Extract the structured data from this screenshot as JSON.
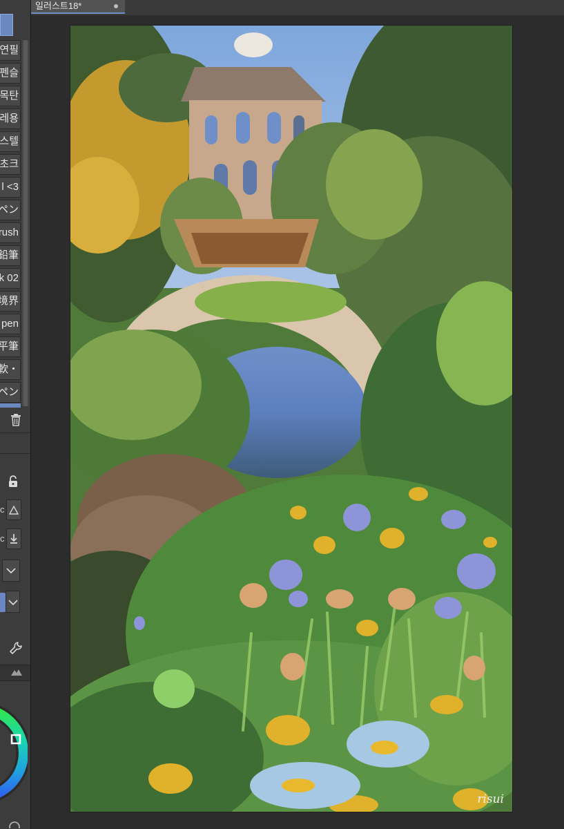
{
  "document": {
    "tab_title": "일러스트18*"
  },
  "brushes": [
    "연필",
    "펜슬",
    "목탄",
    "레용",
    "스텔",
    "초크",
    "l <3",
    "ペン",
    "rush",
    "鉛筆",
    "k 02",
    "境界",
    "pen",
    "平筆",
    "・軟",
    "ペン"
  ],
  "icons": {
    "trash": "trash-icon",
    "lock": "lock-icon",
    "triangle": "triangle-icon",
    "download": "download-icon",
    "chevron": "chevron-down-icon",
    "wrench": "wrench-icon",
    "mountain": "mountain-icon",
    "color_wheel": "color-wheel-icon"
  },
  "artwork": {
    "signature": "risui"
  },
  "colors": {
    "accent": "#6a89c0",
    "panel": "#3c3c3c",
    "canvas_bg": "#2c2c2c"
  }
}
